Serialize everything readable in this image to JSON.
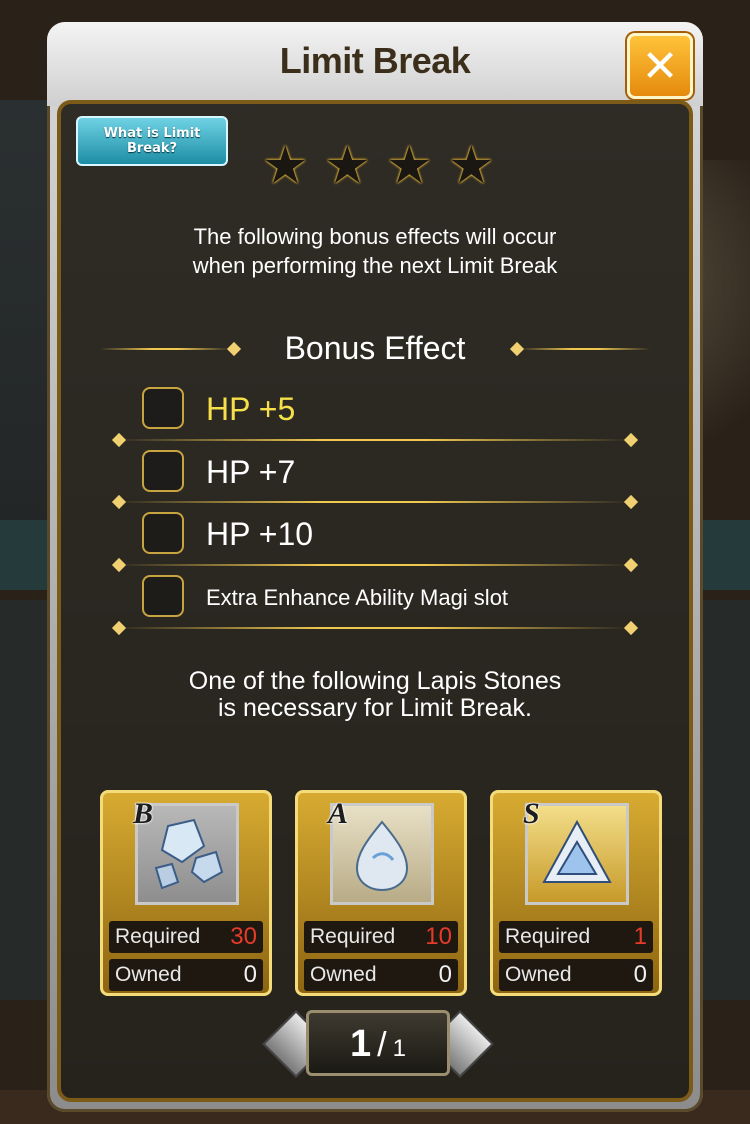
{
  "dialog": {
    "title": "Limit Break",
    "close_icon": "close-icon",
    "help_button": "What is Limit\nBreak?",
    "rarity_stars": 4,
    "description": "The following bonus effects will occur\nwhen performing the next Limit Break",
    "bonus_title": "Bonus Effect",
    "bonus_effects": [
      {
        "label": "HP +5",
        "active": true
      },
      {
        "label": "HP +7",
        "active": false
      },
      {
        "label": "HP +10",
        "active": false
      },
      {
        "label": "Extra Enhance Ability Magi slot",
        "active": false
      }
    ],
    "note": "One of the following Lapis Stones\nis necessary for Limit Break.",
    "required_label": "Required",
    "owned_label": "Owned",
    "stones": [
      {
        "rank": "B",
        "required": "30",
        "owned": "0"
      },
      {
        "rank": "A",
        "required": "10",
        "owned": "0"
      },
      {
        "rank": "S",
        "required": "1",
        "owned": "0"
      }
    ],
    "pager": {
      "current": "1",
      "separator": "/",
      "total": "1"
    }
  },
  "colors": {
    "accent_gold": "#d7ab31",
    "active_bonus": "#f5e04a",
    "required_value": "#e63b2a",
    "help_button": "#1d8da4",
    "close_button": "#e58a0d"
  }
}
